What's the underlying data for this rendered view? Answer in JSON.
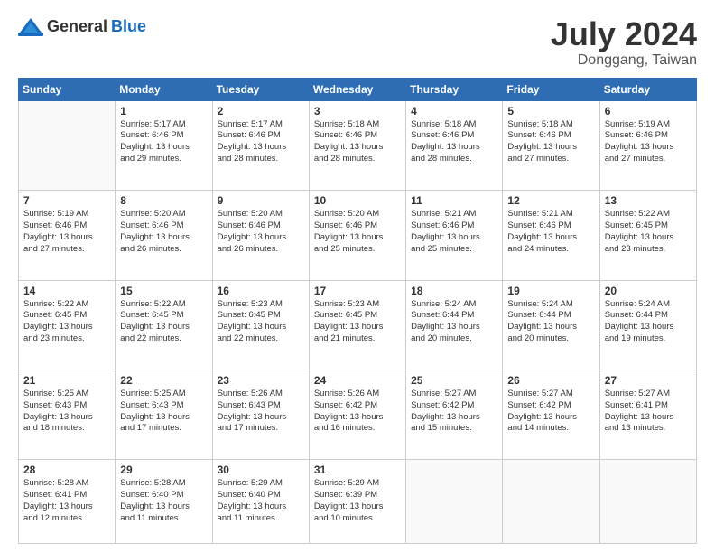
{
  "header": {
    "logo": {
      "general": "General",
      "blue": "Blue"
    },
    "title": "July 2024",
    "location": "Donggang, Taiwan"
  },
  "weekdays": [
    "Sunday",
    "Monday",
    "Tuesday",
    "Wednesday",
    "Thursday",
    "Friday",
    "Saturday"
  ],
  "weeks": [
    [
      {
        "day": "",
        "info": ""
      },
      {
        "day": "1",
        "info": "Sunrise: 5:17 AM\nSunset: 6:46 PM\nDaylight: 13 hours\nand 29 minutes."
      },
      {
        "day": "2",
        "info": "Sunrise: 5:17 AM\nSunset: 6:46 PM\nDaylight: 13 hours\nand 28 minutes."
      },
      {
        "day": "3",
        "info": "Sunrise: 5:18 AM\nSunset: 6:46 PM\nDaylight: 13 hours\nand 28 minutes."
      },
      {
        "day": "4",
        "info": "Sunrise: 5:18 AM\nSunset: 6:46 PM\nDaylight: 13 hours\nand 28 minutes."
      },
      {
        "day": "5",
        "info": "Sunrise: 5:18 AM\nSunset: 6:46 PM\nDaylight: 13 hours\nand 27 minutes."
      },
      {
        "day": "6",
        "info": "Sunrise: 5:19 AM\nSunset: 6:46 PM\nDaylight: 13 hours\nand 27 minutes."
      }
    ],
    [
      {
        "day": "7",
        "info": "Sunrise: 5:19 AM\nSunset: 6:46 PM\nDaylight: 13 hours\nand 27 minutes."
      },
      {
        "day": "8",
        "info": "Sunrise: 5:20 AM\nSunset: 6:46 PM\nDaylight: 13 hours\nand 26 minutes."
      },
      {
        "day": "9",
        "info": "Sunrise: 5:20 AM\nSunset: 6:46 PM\nDaylight: 13 hours\nand 26 minutes."
      },
      {
        "day": "10",
        "info": "Sunrise: 5:20 AM\nSunset: 6:46 PM\nDaylight: 13 hours\nand 25 minutes."
      },
      {
        "day": "11",
        "info": "Sunrise: 5:21 AM\nSunset: 6:46 PM\nDaylight: 13 hours\nand 25 minutes."
      },
      {
        "day": "12",
        "info": "Sunrise: 5:21 AM\nSunset: 6:46 PM\nDaylight: 13 hours\nand 24 minutes."
      },
      {
        "day": "13",
        "info": "Sunrise: 5:22 AM\nSunset: 6:45 PM\nDaylight: 13 hours\nand 23 minutes."
      }
    ],
    [
      {
        "day": "14",
        "info": "Sunrise: 5:22 AM\nSunset: 6:45 PM\nDaylight: 13 hours\nand 23 minutes."
      },
      {
        "day": "15",
        "info": "Sunrise: 5:22 AM\nSunset: 6:45 PM\nDaylight: 13 hours\nand 22 minutes."
      },
      {
        "day": "16",
        "info": "Sunrise: 5:23 AM\nSunset: 6:45 PM\nDaylight: 13 hours\nand 22 minutes."
      },
      {
        "day": "17",
        "info": "Sunrise: 5:23 AM\nSunset: 6:45 PM\nDaylight: 13 hours\nand 21 minutes."
      },
      {
        "day": "18",
        "info": "Sunrise: 5:24 AM\nSunset: 6:44 PM\nDaylight: 13 hours\nand 20 minutes."
      },
      {
        "day": "19",
        "info": "Sunrise: 5:24 AM\nSunset: 6:44 PM\nDaylight: 13 hours\nand 20 minutes."
      },
      {
        "day": "20",
        "info": "Sunrise: 5:24 AM\nSunset: 6:44 PM\nDaylight: 13 hours\nand 19 minutes."
      }
    ],
    [
      {
        "day": "21",
        "info": "Sunrise: 5:25 AM\nSunset: 6:43 PM\nDaylight: 13 hours\nand 18 minutes."
      },
      {
        "day": "22",
        "info": "Sunrise: 5:25 AM\nSunset: 6:43 PM\nDaylight: 13 hours\nand 17 minutes."
      },
      {
        "day": "23",
        "info": "Sunrise: 5:26 AM\nSunset: 6:43 PM\nDaylight: 13 hours\nand 17 minutes."
      },
      {
        "day": "24",
        "info": "Sunrise: 5:26 AM\nSunset: 6:42 PM\nDaylight: 13 hours\nand 16 minutes."
      },
      {
        "day": "25",
        "info": "Sunrise: 5:27 AM\nSunset: 6:42 PM\nDaylight: 13 hours\nand 15 minutes."
      },
      {
        "day": "26",
        "info": "Sunrise: 5:27 AM\nSunset: 6:42 PM\nDaylight: 13 hours\nand 14 minutes."
      },
      {
        "day": "27",
        "info": "Sunrise: 5:27 AM\nSunset: 6:41 PM\nDaylight: 13 hours\nand 13 minutes."
      }
    ],
    [
      {
        "day": "28",
        "info": "Sunrise: 5:28 AM\nSunset: 6:41 PM\nDaylight: 13 hours\nand 12 minutes."
      },
      {
        "day": "29",
        "info": "Sunrise: 5:28 AM\nSunset: 6:40 PM\nDaylight: 13 hours\nand 11 minutes."
      },
      {
        "day": "30",
        "info": "Sunrise: 5:29 AM\nSunset: 6:40 PM\nDaylight: 13 hours\nand 11 minutes."
      },
      {
        "day": "31",
        "info": "Sunrise: 5:29 AM\nSunset: 6:39 PM\nDaylight: 13 hours\nand 10 minutes."
      },
      {
        "day": "",
        "info": ""
      },
      {
        "day": "",
        "info": ""
      },
      {
        "day": "",
        "info": ""
      }
    ]
  ]
}
